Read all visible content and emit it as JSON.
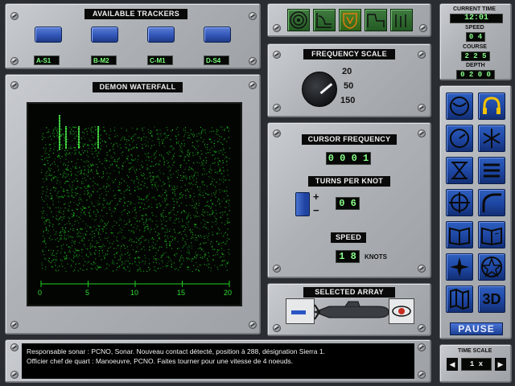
{
  "trackers": {
    "title": "AVAILABLE TRACKERS",
    "items": [
      {
        "label": "A-S1"
      },
      {
        "label": "B-M2"
      },
      {
        "label": "C-M1"
      },
      {
        "label": "D-S4"
      }
    ]
  },
  "waterfall": {
    "title": "DEMON WATERFALL",
    "axis_ticks": [
      "0",
      "5",
      "10",
      "15",
      "20"
    ]
  },
  "frequency_scale": {
    "title": "FREQUENCY SCALE",
    "options": [
      "20",
      "50",
      "150"
    ]
  },
  "cursor": {
    "title": "CURSOR FREQUENCY",
    "value": "0 0 0 1"
  },
  "turns_per_knot": {
    "title": "TURNS PER KNOT",
    "value": "0 6",
    "plus": "+",
    "minus": "−"
  },
  "speed_panel": {
    "title": "SPEED",
    "value": "1 8",
    "unit": "KNOTS"
  },
  "selected_array": {
    "title": "SELECTED ARRAY"
  },
  "status": {
    "current_time_label": "CURRENT TIME",
    "current_time": "12:01",
    "speed_label": "SPEED",
    "speed": "0 4",
    "course_label": "COURSE",
    "course": "2 2 5",
    "depth_label": "DEPTH",
    "depth": "0 2 0 0"
  },
  "pause_label": "PAUSE",
  "time_scale": {
    "title": "TIME SCALE",
    "value": "1 x"
  },
  "tool_3d_label": "3D",
  "messages": [
    "Responsable sonar : PCNO, Sonar. Nouveau contact détecté, position à 288, désignation Sierra 1.",
    "Officier chef de quart : Manoeuvre, PCNO. Faites tourner pour une vitesse de 4 noeuds."
  ],
  "colors": {
    "accent_blue": "#1d46a2",
    "lcd_green": "#8aff8a",
    "plot_green": "#1fcf1f"
  }
}
